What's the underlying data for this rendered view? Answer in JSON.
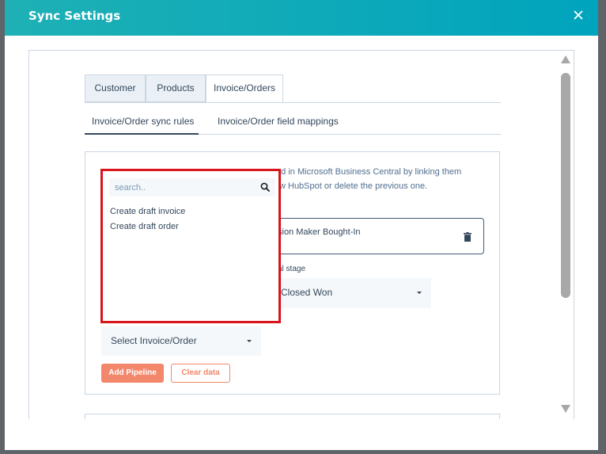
{
  "modal": {
    "title": "Sync Settings",
    "close_icon": "close-icon",
    "accent_colors": {
      "header": "#00a4bd",
      "primary_button": "#f2876b",
      "highlight_border": "#d9141b"
    }
  },
  "tabs": [
    {
      "label": "Customer",
      "active": false
    },
    {
      "label": "Products",
      "active": false
    },
    {
      "label": "Invoice/Orders",
      "active": true
    }
  ],
  "subtabs": [
    {
      "label": "Invoice/Order sync rules",
      "active": true
    },
    {
      "label": "Invoice/Order field mappings",
      "active": false
    }
  ],
  "content": {
    "description_line1": "ted in Microsoft Business Central by linking them",
    "description_line2": "w HubSpot or delete the previous one.",
    "mapping_value": "sion Maker Bought-In",
    "deal_stage_label": "al stage",
    "deal_stage_value": "Closed Won",
    "invoice_select_value": "Select Invoice/Order",
    "add_pipeline_label": "Add Pipeline",
    "clear_data_label": "Clear data"
  },
  "dropdown": {
    "search_placeholder": "search..",
    "options": [
      "Create draft invoice",
      "Create draft order"
    ]
  }
}
